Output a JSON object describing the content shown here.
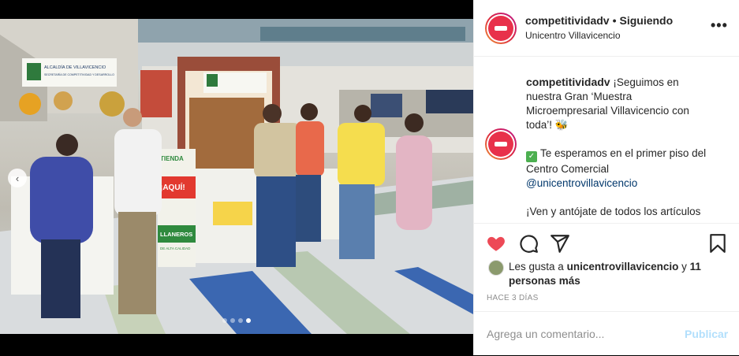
{
  "post": {
    "username": "competitividadv",
    "separator": "•",
    "follow_status": "Siguiendo",
    "location": "Unicentro Villavicencio",
    "more_icon": "more-dots-icon"
  },
  "caption": {
    "username": "competitividadv",
    "line1": "¡Seguimos en nuestra Gran ‘Muestra Microempresarial Villavicencio con toda’! 🐝",
    "line2_emoji": "✓",
    "line2": "Te esperamos en el primer piso del Centro Comercial",
    "line2_mention": "@unicentrovillavicencio",
    "line3": "¡Ven y antójate de todos los artículos"
  },
  "actions": {
    "like_icon": "heart-icon",
    "comment_icon": "comment-icon",
    "share_icon": "share-icon",
    "save_icon": "bookmark-icon",
    "like_color": "#ed4956"
  },
  "likes": {
    "prefix": "Les gusta a",
    "user": "unicentrovillavicencio",
    "connector": "y",
    "others": "11 personas más"
  },
  "timestamp": "HACE 3 DÍAS",
  "add_comment": {
    "placeholder": "Agrega un comentario...",
    "post_label": "Publicar"
  },
  "media": {
    "prev_icon": "chevron-left-icon",
    "dot_count": 4,
    "active_dot": 4,
    "banner_text_1": "ALCALDÍA DE VILLAVICENCIO",
    "banner_text_2": "SECRETARÍA DE COMPETITIVIDAD Y DESARROLLO",
    "sign_text_1": "TIENDA",
    "sign_text_2": "¡AQUÍ!",
    "sign_text_3": "LLANEROS",
    "sign_text_4": "DE ALTA CALIDAD"
  }
}
